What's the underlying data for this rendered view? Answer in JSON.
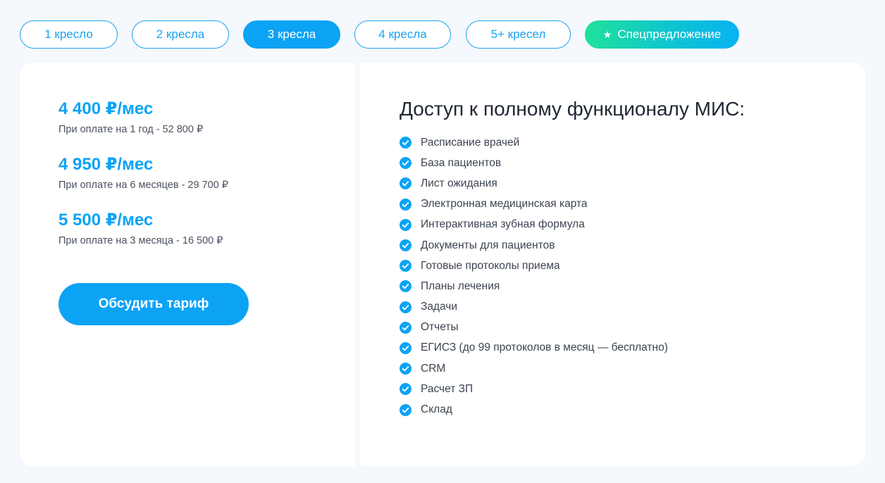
{
  "tabs": [
    {
      "label": "1 кресло",
      "active": false
    },
    {
      "label": "2 кресла",
      "active": false
    },
    {
      "label": "3 кресла",
      "active": true
    },
    {
      "label": "4 кресла",
      "active": false
    },
    {
      "label": "5+ кресел",
      "active": false
    }
  ],
  "special_tab": {
    "label": "Спецпредложение",
    "icon": "star-icon"
  },
  "pricing": [
    {
      "price": "4 400 ₽/мес",
      "note": "При оплате на 1 год - 52 800 ₽"
    },
    {
      "price": "4 950 ₽/мес",
      "note": "При оплате на 6 месяцев - 29 700 ₽"
    },
    {
      "price": "5 500 ₽/мес",
      "note": "При оплате на 3 месяца - 16 500 ₽"
    }
  ],
  "discuss_button": "Обсудить тариф",
  "features_title": "Доступ к полному функционалу МИС:",
  "features": [
    "Расписание врачей",
    "База пациентов",
    "Лист ожидания",
    "Электронная медицинская карта",
    "Интерактивная зубная формула",
    "Документы для пациентов",
    "Готовые протоколы приема",
    "Планы лечения",
    "Задачи",
    "Отчеты",
    "ЕГИСЗ (до 99 протоколов в месяц — бесплатно)",
    "CRM",
    "Расчет ЗП",
    "Склад"
  ],
  "colors": {
    "accent": "#0ca3f5",
    "special_gradient_start": "#1fe19a",
    "special_gradient_end": "#08b2f3"
  }
}
